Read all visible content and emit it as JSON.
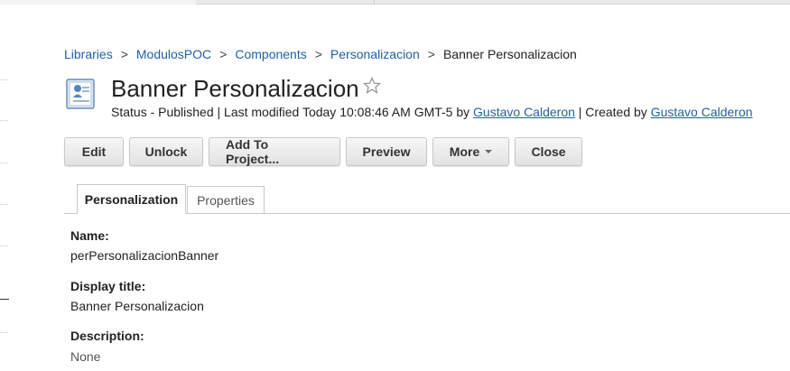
{
  "breadcrumb": {
    "items": [
      "Libraries",
      "ModulosPOC",
      "Components",
      "Personalizacion"
    ],
    "separator": ">",
    "current": "Banner Personalizacion"
  },
  "header": {
    "title": "Banner Personalizacion",
    "status_prefix": "Status - Published | Last modified Today 10:08:46 AM GMT-5 by",
    "modified_by": "Gustavo Calderon",
    "created_prefix": "| Created by",
    "created_by": "Gustavo Calderon"
  },
  "toolbar": {
    "edit": "Edit",
    "unlock": "Unlock",
    "add_to_project": "Add To Project...",
    "preview": "Preview",
    "more": "More",
    "close": "Close"
  },
  "tabs": {
    "personalization": "Personalization",
    "properties": "Properties"
  },
  "fields": {
    "name_label": "Name:",
    "name_value": "perPersonalizacionBanner",
    "display_title_label": "Display title:",
    "display_title_value": "Banner Personalizacion",
    "description_label": "Description:",
    "description_value": "None"
  },
  "colors": {
    "link": "#2060a8",
    "button_bg": "#e8e8e8",
    "border": "#c8c8c8"
  },
  "icons": {
    "item": "document-icon",
    "favorite": "star-outline-icon",
    "more_menu": "caret-down-icon"
  }
}
